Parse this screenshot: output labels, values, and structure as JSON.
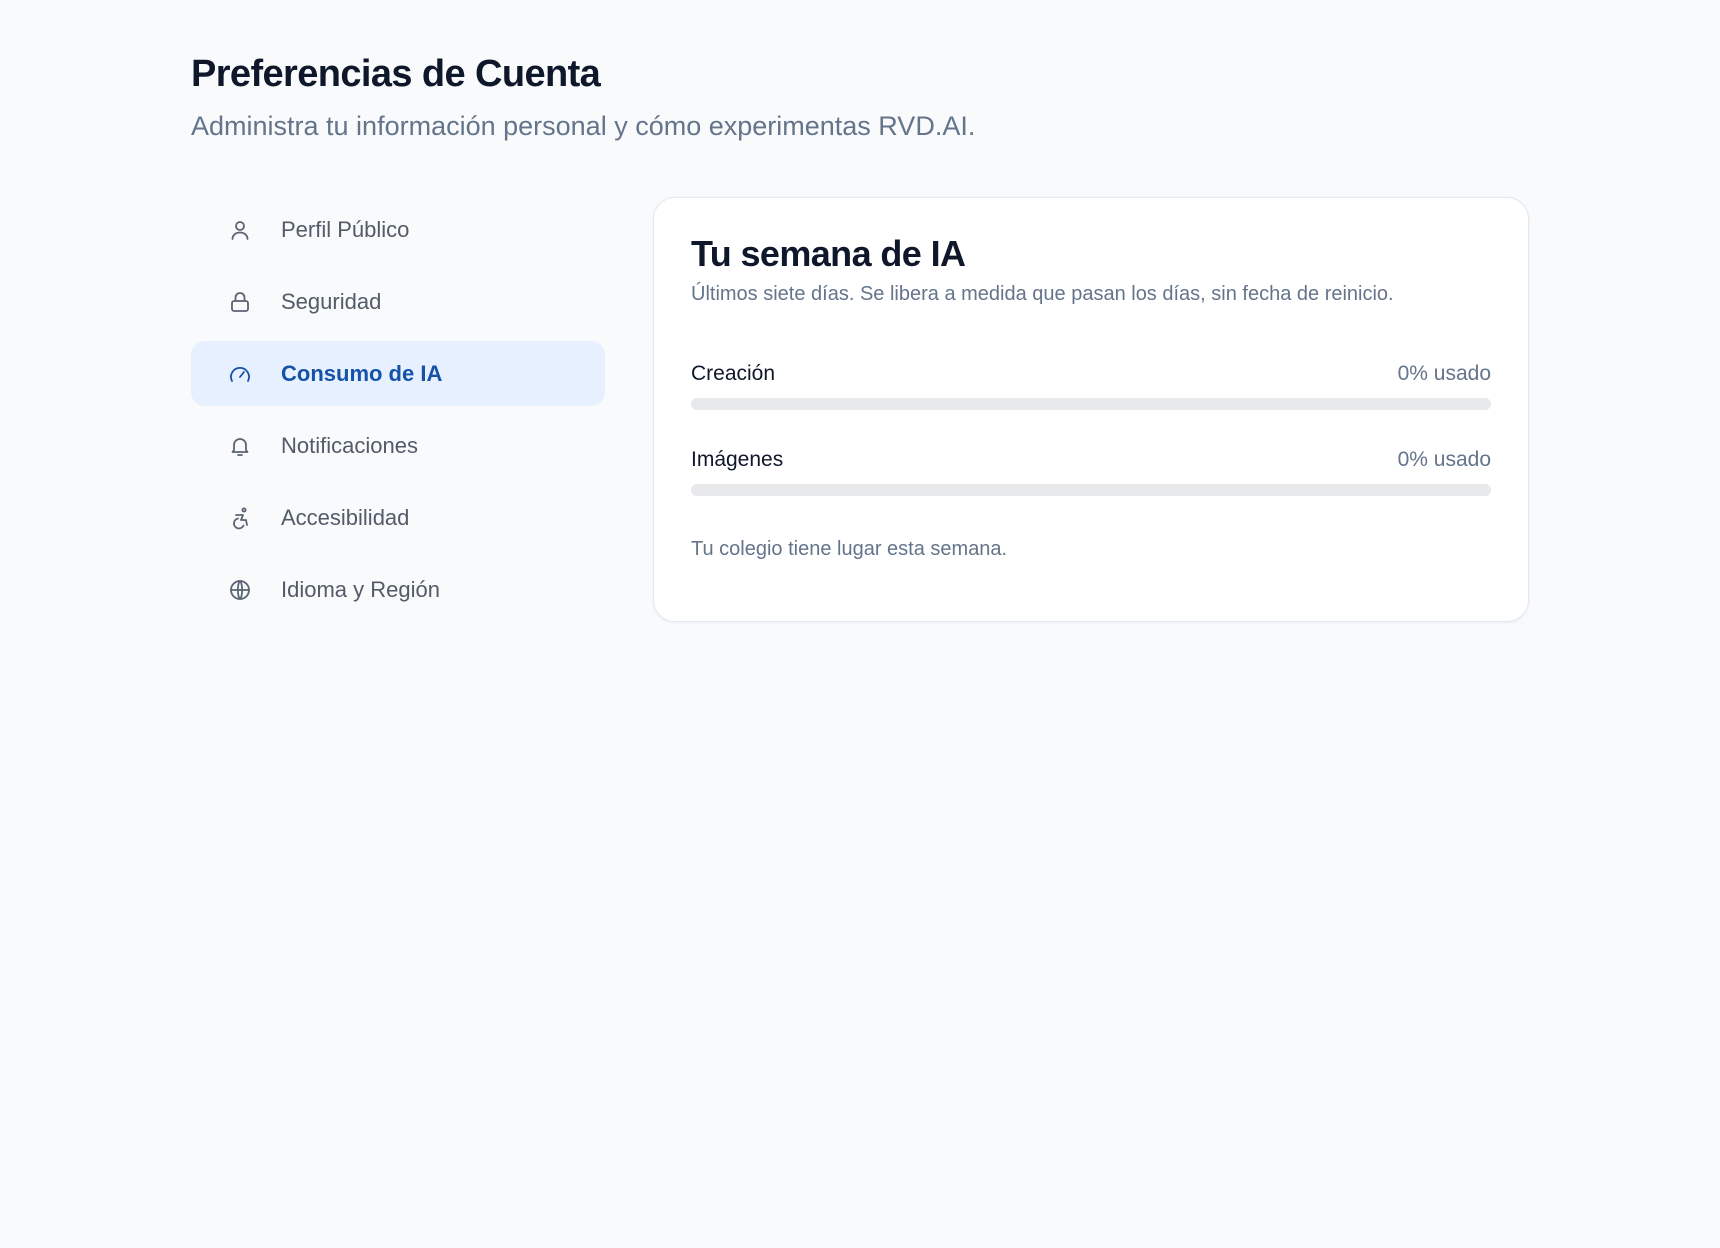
{
  "header": {
    "title": "Preferencias de Cuenta",
    "subtitle": "Administra tu información personal y cómo experimentas RVD.AI."
  },
  "sidebar": {
    "items": [
      {
        "label": "Perfil Público",
        "icon": "user-icon",
        "active": false
      },
      {
        "label": "Seguridad",
        "icon": "lock-icon",
        "active": false
      },
      {
        "label": "Consumo de IA",
        "icon": "gauge-icon",
        "active": true
      },
      {
        "label": "Notificaciones",
        "icon": "bell-icon",
        "active": false
      },
      {
        "label": "Accesibilidad",
        "icon": "accessibility-icon",
        "active": false
      },
      {
        "label": "Idioma y Región",
        "icon": "globe-icon",
        "active": false
      }
    ]
  },
  "card": {
    "title": "Tu semana de IA",
    "subtitle": "Últimos siete días. Se libera a medida que pasan los días, sin fecha de reinicio.",
    "usage": [
      {
        "label": "Creación",
        "value_text": "0% usado",
        "percent": 0
      },
      {
        "label": "Imágenes",
        "value_text": "0% usado",
        "percent": 0
      }
    ],
    "note": "Tu colegio tiene lugar esta semana."
  },
  "colors": {
    "background": "#f8fafc",
    "accent": "#1552a8",
    "active_bg": "#e6f0ff",
    "muted_text": "#64748b",
    "bar_track": "#e8e9eb"
  }
}
